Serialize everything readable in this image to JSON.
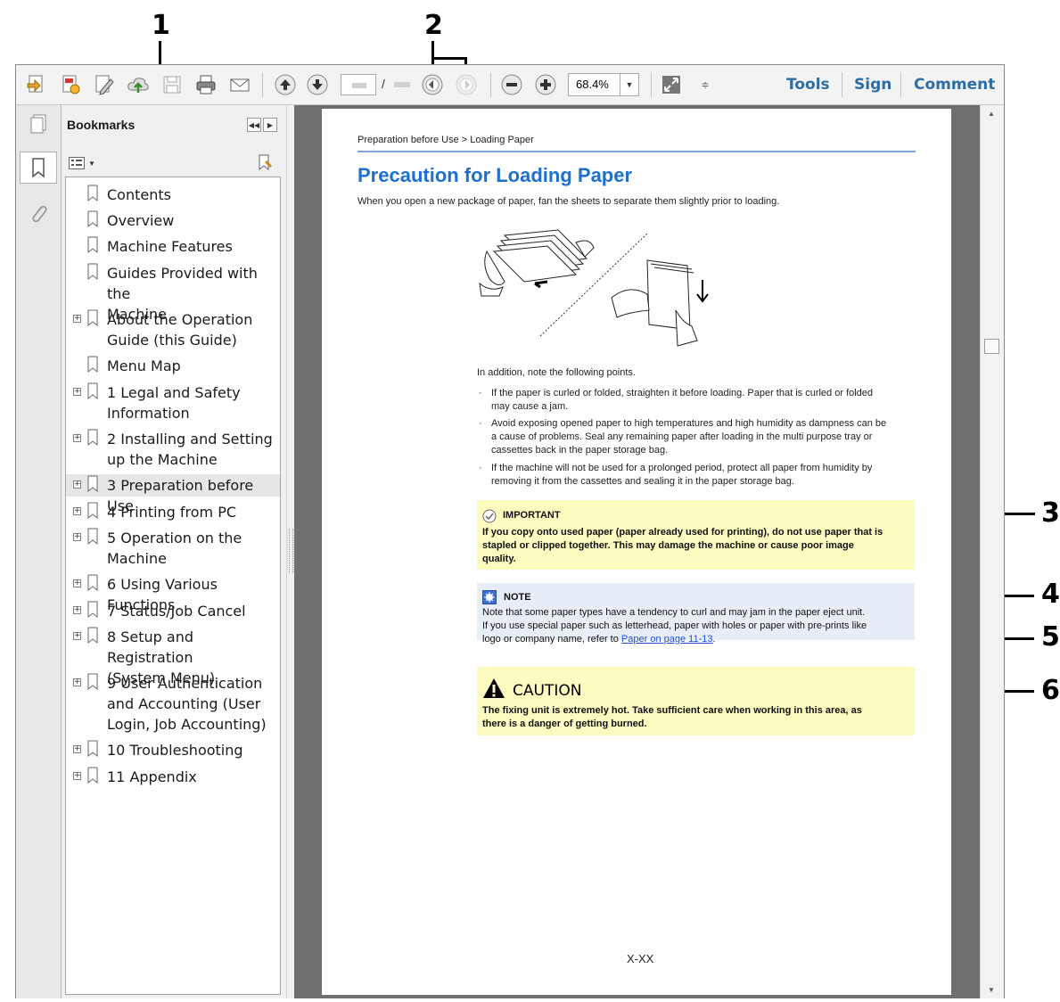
{
  "callouts": [
    "1",
    "2",
    "3",
    "4",
    "5",
    "6"
  ],
  "toolbar": {
    "icons": [
      "create-pdf-icon",
      "export-icon",
      "edit-icon",
      "upload-icon",
      "save-icon",
      "print-icon",
      "email-icon",
      "page-up-icon",
      "page-down-icon",
      "previous-view-icon",
      "next-view-icon",
      "zoom-out-icon",
      "zoom-in-icon",
      "fit-page-icon",
      "toolbar-menu-icon"
    ],
    "page_separator": "/",
    "zoom_value": "68.4%",
    "tools_label": "Tools",
    "sign_label": "Sign",
    "comment_label": "Comment"
  },
  "nav_icons": [
    "page-thumbnails-icon",
    "bookmarks-icon",
    "attachments-icon"
  ],
  "bookmarks": {
    "title": "Bookmarks",
    "items": [
      {
        "label": "Contents",
        "expandable": false
      },
      {
        "label": "Overview",
        "expandable": false
      },
      {
        "label": "Machine Features",
        "expandable": false
      },
      {
        "label": "Guides Provided with the\nMachine",
        "expandable": false
      },
      {
        "label": "About the Operation\nGuide (this Guide)",
        "expandable": true
      },
      {
        "label": "Menu Map",
        "expandable": false
      },
      {
        "label": "1 Legal and Safety\nInformation",
        "expandable": true
      },
      {
        "label": "2 Installing and Setting\nup the Machine",
        "expandable": true
      },
      {
        "label": "3 Preparation before Use",
        "expandable": true,
        "selected": true
      },
      {
        "label": "4 Printing from PC",
        "expandable": true
      },
      {
        "label": "5 Operation on the\nMachine",
        "expandable": true
      },
      {
        "label": "6 Using Various Functions",
        "expandable": true
      },
      {
        "label": "7 Status/Job Cancel",
        "expandable": true
      },
      {
        "label": "8 Setup and Registration\n(System Menu)",
        "expandable": true
      },
      {
        "label": "9 User Authentication\nand Accounting (User\nLogin, Job Accounting)",
        "expandable": true
      },
      {
        "label": "10 Troubleshooting",
        "expandable": true
      },
      {
        "label": "11 Appendix",
        "expandable": true
      }
    ]
  },
  "document": {
    "breadcrumb": "Preparation before Use > Loading Paper",
    "title": "Precaution for Loading Paper",
    "intro": "When you open a new package of paper, fan the sheets to separate them slightly prior to loading.",
    "points_intro": "In addition, note the following points.",
    "bullets": [
      "If the paper is curled or folded, straighten it before loading. Paper that is curled or folded\nmay cause a jam.",
      "Avoid exposing opened paper to high temperatures and high humidity as dampness can be\na cause of problems. Seal any remaining paper after loading in the multi purpose tray or\ncassettes back in the paper storage bag.",
      "If the machine will not be used for a prolonged period, protect all paper from humidity by\nremoving it from the cassettes and sealing it in the paper storage bag."
    ],
    "bullet_marker": "·",
    "important": {
      "heading": "IMPORTANT",
      "body": "If you copy onto used paper (paper already used for printing), do not use paper that is\nstapled or clipped together. This may damage the machine or cause poor image\nquality."
    },
    "note": {
      "heading": "NOTE",
      "body": "Note that some paper types have a tendency to curl and may jam in the paper eject unit.\nIf you use special paper such as letterhead, paper with holes or paper with pre-prints like\nlogo or company name, refer to ",
      "link": "Paper on page 11-13",
      "trailing": "."
    },
    "caution": {
      "heading": "CAUTION",
      "body": "The fixing unit is extremely hot. Take sufficient care when working in this area, as\nthere is a danger of getting burned."
    },
    "footer": "X-XX"
  }
}
